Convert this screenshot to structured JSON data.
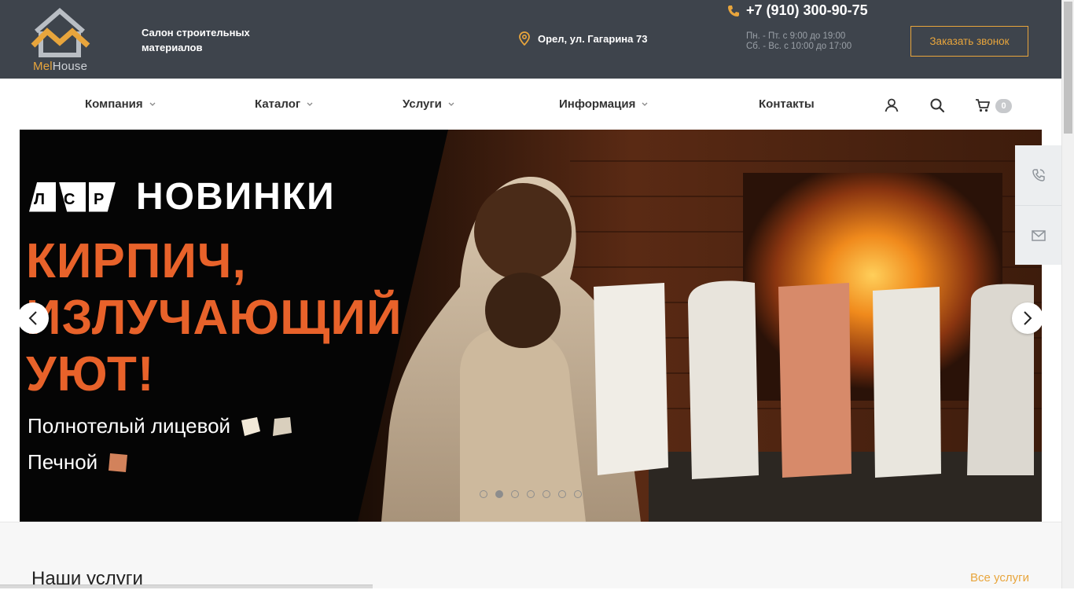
{
  "header": {
    "logo": {
      "brand_left": "Mel",
      "brand_right": "House",
      "icon": "house-logo-icon"
    },
    "tagline": "Салон строительных материалов",
    "address": "Орел, ул. Гагарина 73",
    "phone": "+7 (910) 300-90-75",
    "hours_weekdays": "Пн. - Пт. с 9:00 до 19:00",
    "hours_weekend": "Сб. - Вс. с 10:00 до 17:00",
    "callback_label": "Заказать звонок",
    "colors": {
      "header_bg": "#3e444c",
      "accent": "#e8a53c"
    }
  },
  "nav": {
    "items": [
      {
        "label": "Компания",
        "has_dropdown": true
      },
      {
        "label": "Каталог",
        "has_dropdown": true
      },
      {
        "label": "Услуги",
        "has_dropdown": true
      },
      {
        "label": "Информация",
        "has_dropdown": true
      },
      {
        "label": "Контакты",
        "has_dropdown": false
      }
    ],
    "icons": [
      "user-icon",
      "search-icon",
      "cart-icon"
    ],
    "cart_count": "0"
  },
  "slider": {
    "brand_letters": [
      "Л",
      "С",
      "Р"
    ],
    "brand_title": "НОВИНКИ",
    "headline_lines": [
      "КИРПИЧ,",
      "ИЗЛУЧАЮЩИЙ",
      "УЮТ!"
    ],
    "product_1": "Полнотелый лицевой",
    "product_2": "Печной",
    "slide_count": 7,
    "active_slide": 2,
    "colors": {
      "headline": "#e8622a"
    }
  },
  "side_widget": {
    "icons": [
      "phone-icon",
      "mail-icon"
    ]
  },
  "section": {
    "title": "Наши услуги",
    "all_link": "Все услуги"
  }
}
